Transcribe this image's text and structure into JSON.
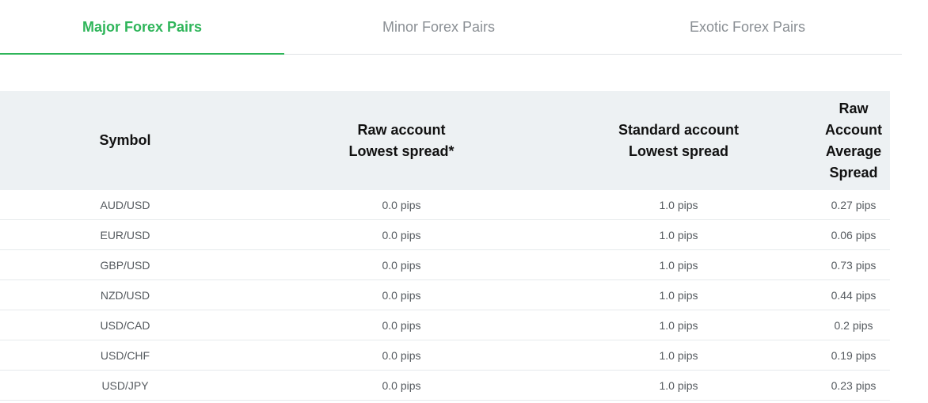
{
  "tabs": [
    {
      "label": "Major Forex Pairs",
      "active": true
    },
    {
      "label": "Minor Forex Pairs",
      "active": false
    },
    {
      "label": "Exotic Forex Pairs",
      "active": false
    }
  ],
  "table": {
    "headers": [
      "Symbol",
      "Raw account\nLowest spread*",
      "Standard account\nLowest spread",
      "Raw\nAccount\nAverage\nSpread"
    ],
    "rows": [
      [
        "AUD/USD",
        "0.0 pips",
        "1.0 pips",
        "0.27 pips"
      ],
      [
        "EUR/USD",
        "0.0 pips",
        "1.0 pips",
        "0.06 pips"
      ],
      [
        "GBP/USD",
        "0.0 pips",
        "1.0 pips",
        "0.73 pips"
      ],
      [
        "NZD/USD",
        "0.0 pips",
        "1.0 pips",
        "0.44 pips"
      ],
      [
        "USD/CAD",
        "0.0 pips",
        "1.0 pips",
        "0.2 pips"
      ],
      [
        "USD/CHF",
        "0.0 pips",
        "1.0 pips",
        "0.19 pips"
      ],
      [
        "USD/JPY",
        "0.0 pips",
        "1.0 pips",
        "0.23 pips"
      ]
    ]
  },
  "colors": {
    "accent": "#2fb55a",
    "header_bg": "#edf1f3",
    "inactive_tab": "#8a8f94"
  }
}
